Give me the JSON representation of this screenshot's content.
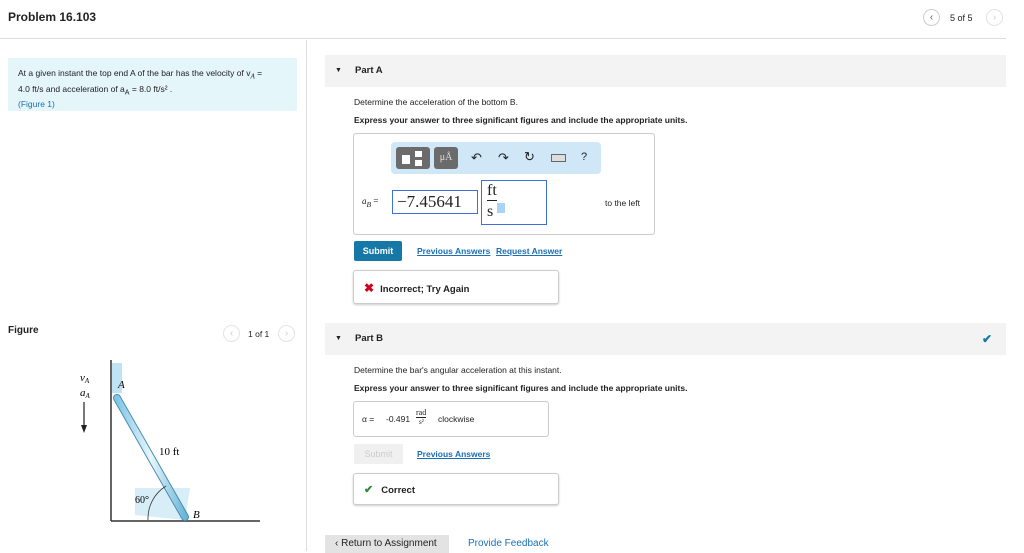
{
  "header": {
    "title": "Problem 16.103",
    "pager": "5 of 5"
  },
  "problem": {
    "line1": "At a given instant the top end A of the bar has the velocity of v",
    "line1_sub": "A",
    "line1_end": " =",
    "line2a": "4.0 ft/s and acceleration of a",
    "line2_sub": "A",
    "line2b": " = 8.0 ft/s² .",
    "figure_link": "(Figure 1)"
  },
  "figure": {
    "label": "Figure",
    "pager": "1 of 1",
    "v_label": "v",
    "a_label": "a",
    "sub": "A",
    "point_a": "A",
    "point_b": "B",
    "length": "10 ft",
    "angle": "60°"
  },
  "partA": {
    "title": "Part A",
    "question": "Determine the acceleration of the bottom B.",
    "instruction": "Express your answer to three significant figures and include the appropriate units.",
    "toolbar": {
      "mu": "μÅ",
      "help": "?"
    },
    "var_label": "a",
    "var_sub": "B",
    "eq": " =",
    "value": "−7.45641",
    "unit_num": "ft",
    "unit_den": "s",
    "direction": "to the left",
    "submit": "Submit",
    "previous": "Previous Answers",
    "request": "Request Answer",
    "feedback": "Incorrect; Try Again"
  },
  "partB": {
    "title": "Part B",
    "question": "Determine the bar's angular acceleration at this instant.",
    "instruction": "Express your answer to three significant figures and include the appropriate units.",
    "var_label": "α =",
    "value": "-0.491",
    "unit_num": "rad",
    "unit_den": "s²",
    "direction": "clockwise",
    "submit": "Submit",
    "previous": "Previous Answers",
    "feedback": "Correct"
  },
  "footer": {
    "return": "Return to Assignment",
    "feedback": "Provide Feedback"
  },
  "colors": {
    "accent": "#1578a6",
    "error": "#d0021b",
    "success": "#2e8b3a"
  }
}
